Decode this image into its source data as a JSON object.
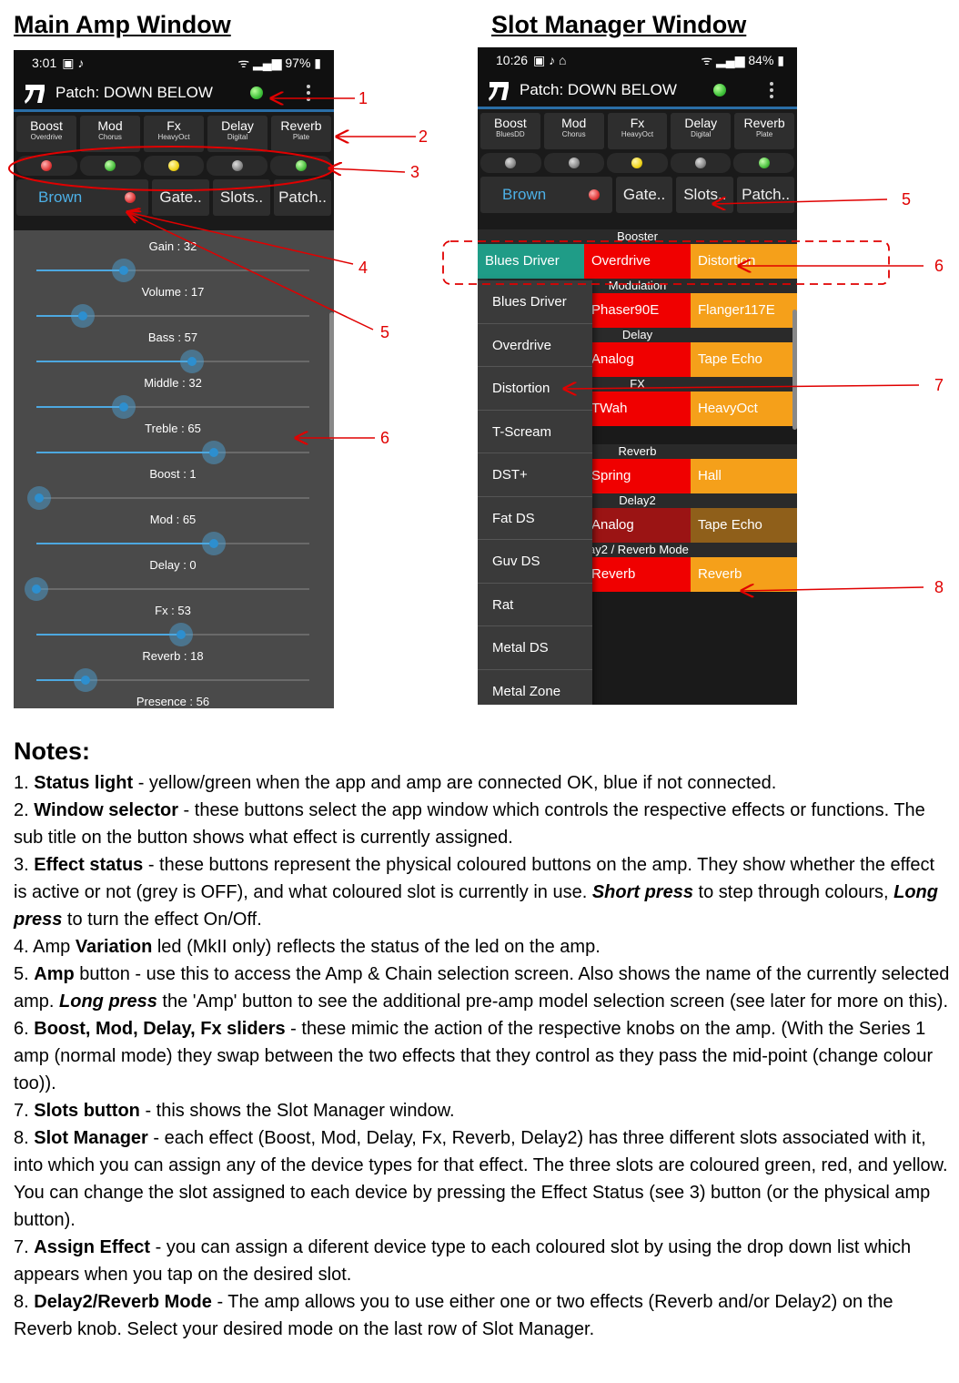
{
  "headings": {
    "main": "Main Amp Window",
    "slot": "Slot Manager Window"
  },
  "main_phone": {
    "time": "3:01",
    "battery": "97%",
    "patch_title": "Patch: DOWN BELOW",
    "fx_buttons": [
      {
        "label": "Boost",
        "sub": "Overdrive"
      },
      {
        "label": "Mod",
        "sub": "Chorus"
      },
      {
        "label": "Fx",
        "sub": "HeavyOct"
      },
      {
        "label": "Delay",
        "sub": "Digital"
      },
      {
        "label": "Reverb",
        "sub": "Plate"
      }
    ],
    "leds": [
      "red",
      "green",
      "yellow",
      "grey",
      "green"
    ],
    "amp_label": "Brown",
    "nav": [
      "Gate..",
      "Slots..",
      "Patch.."
    ],
    "sliders": [
      {
        "label": "Gain : 32",
        "value": 32
      },
      {
        "label": "Volume : 17",
        "value": 17
      },
      {
        "label": "Bass : 57",
        "value": 57
      },
      {
        "label": "Middle : 32",
        "value": 32
      },
      {
        "label": "Treble : 65",
        "value": 65
      },
      {
        "label": "Boost : 1",
        "value": 1
      },
      {
        "label": "Mod : 65",
        "value": 65
      },
      {
        "label": "Delay : 0",
        "value": 0
      },
      {
        "label": "Fx : 53",
        "value": 53
      },
      {
        "label": "Reverb : 18",
        "value": 18
      },
      {
        "label": "Presence : 56",
        "value": 56
      }
    ]
  },
  "slot_phone": {
    "time": "10:26",
    "battery": "84%",
    "patch_title": "Patch: DOWN BELOW",
    "fx_buttons": [
      {
        "label": "Boost",
        "sub": "BluesDD"
      },
      {
        "label": "Mod",
        "sub": "Chorus"
      },
      {
        "label": "Fx",
        "sub": "HeavyOct"
      },
      {
        "label": "Delay",
        "sub": "Digital"
      },
      {
        "label": "Reverb",
        "sub": "Plate"
      }
    ],
    "leds": [
      "grey",
      "grey",
      "yellow",
      "grey",
      "green"
    ],
    "amp_label": "Brown",
    "nav": [
      "Gate..",
      "Slots..",
      "Patch.."
    ],
    "sections": [
      {
        "title": "Booster",
        "slots": [
          "Blues Driver",
          "Overdrive",
          "Distortion"
        ]
      },
      {
        "title": "Modulation",
        "slots": [
          "",
          "Phaser90E",
          "Flanger117E"
        ]
      },
      {
        "title": "Delay",
        "slots": [
          "",
          "Analog",
          "Tape Echo"
        ]
      },
      {
        "title": "FX",
        "slots": [
          "",
          "TWah",
          "HeavyOct"
        ]
      },
      {
        "title": "Reverb",
        "slots": [
          "",
          "Spring",
          "Hall"
        ]
      },
      {
        "title": "Delay2",
        "slots": [
          "",
          "Analog",
          "Tape Echo"
        ]
      },
      {
        "title": "lay2 / Reverb Mode",
        "slots": [
          "",
          "Reverb",
          "Reverb"
        ]
      }
    ],
    "dropdown": [
      "Blues Driver",
      "Overdrive",
      "Distortion",
      "T-Scream",
      "DST+",
      "Fat DS",
      "Guv DS",
      "Rat",
      "Metal DS",
      "Metal Zone"
    ]
  },
  "annotations": [
    "1",
    "2",
    "3",
    "4",
    "5",
    "6",
    "5",
    "6",
    "7",
    "8"
  ],
  "notes_title": "Notes:",
  "notes": [
    {
      "num": "1. ",
      "bold": "Status light",
      "rest": " - yellow/green when the app and amp are connected OK, blue if not connected."
    },
    {
      "num": "2. ",
      "bold": "Window selector",
      "rest": " - these buttons select the app window which controls the respective effects or functions. The sub title on the button shows what effect is currently assigned."
    },
    {
      "num": "3. ",
      "bold": "Effect status",
      "rest": " -  these buttons represent the physical coloured buttons on the amp. They show whether the effect is active or not (grey is OFF), and what coloured slot is currently in use. ",
      "em1": "Short press",
      "rest2": " to step through colours, ",
      "em2": "Long press",
      "rest3": " to turn the effect On/Off."
    },
    {
      "num": "4. Amp ",
      "bold": "Variation",
      "rest": " led (MkII only) reflects the status of the led on the amp."
    },
    {
      "num": "5. ",
      "bold": "Amp",
      "rest": " button - use this to access the Amp & Chain selection screen. Also shows the name of the currently selected amp. ",
      "em1": "Long press",
      "rest2": " the 'Amp' button to see the additional pre-amp model selection screen (see later for more on this)."
    },
    {
      "num": "6. ",
      "bold": "Boost, Mod, Delay, Fx sliders",
      "rest": " - these mimic the action of the respective knobs on the amp. (With the Series 1 amp (normal mode) they swap between the two effects that they control as they pass the mid-point (change colour too))."
    },
    {
      "num": "7. ",
      "bold": "Slots button",
      "rest": " - this shows the Slot Manager window."
    },
    {
      "num": "8. ",
      "bold": "Slot Manager",
      "rest": " - each effect (Boost, Mod, Delay, Fx, Reverb, Delay2) has three different slots associated with it, into which you can assign any of the device types for that effect. The three slots are coloured green, red, and yellow. You can change the slot assigned to each device by pressing the Effect Status (see 3) button (or the physical amp button)."
    },
    {
      "num": "7. ",
      "bold": "Assign Effect",
      "rest": " - you can assign a diferent device type to each coloured slot by using the drop down list which appears when you tap on the desired slot."
    },
    {
      "num": "8. ",
      "bold": "Delay2/Reverb Mode",
      "rest": " - The amp allows you to use either one or two effects (Reverb and/or Delay2) on the Reverb knob. Select your desired mode on the last row of Slot Manager."
    }
  ]
}
